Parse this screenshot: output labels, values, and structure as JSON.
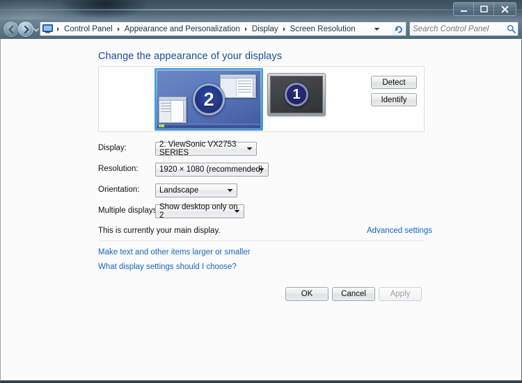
{
  "window": {
    "controls": {
      "minimize": "minimize-button",
      "maximize": "maximize-button",
      "close": "close-button",
      "close_glyph": "X"
    }
  },
  "navbar": {
    "back_tooltip": "Back",
    "forward_tooltip": "Forward",
    "breadcrumbs": [
      "Control Panel",
      "Appearance and Personalization",
      "Display",
      "Screen Resolution"
    ],
    "separator": "▸",
    "dropdown_icon": "chevron-down-icon",
    "refresh_icon": "refresh-icon",
    "search": {
      "placeholder": "Search Control Panel",
      "value": "",
      "icon": "search-icon"
    }
  },
  "page": {
    "title": "Change the appearance of your displays"
  },
  "preview": {
    "monitors": [
      {
        "number": "2",
        "selected": true,
        "active": true,
        "label": "monitor-preview-2"
      },
      {
        "number": "1",
        "selected": false,
        "active": false,
        "label": "monitor-preview-1"
      }
    ],
    "buttons": {
      "detect": "Detect",
      "identify": "Identify"
    }
  },
  "form": {
    "rows": [
      {
        "label": "Display:",
        "value": "2. ViewSonic VX2753 SERIES",
        "name": "display-combo"
      },
      {
        "label": "Resolution:",
        "value": "1920 × 1080 (recommended)",
        "name": "resolution-combo"
      },
      {
        "label": "Orientation:",
        "value": "Landscape",
        "name": "orientation-combo"
      },
      {
        "label": "Multiple displays:",
        "value": "Show desktop only on 2",
        "name": "multiple-displays-combo"
      }
    ]
  },
  "status": {
    "main_display_text": "This is currently your main display.",
    "advanced_settings_link": "Advanced settings"
  },
  "links": {
    "text_size": "Make text and other items larger or smaller",
    "choose_settings": "What display settings should I choose?"
  },
  "dialog_buttons": {
    "ok": "OK",
    "cancel": "Cancel",
    "apply": "Apply",
    "apply_disabled": true
  },
  "colors": {
    "heading_blue": "#184f93",
    "link_blue": "#1766b5",
    "selection_border": "#3c9fe0",
    "content_bg": "#fbfbfc",
    "titlebar_glass": "#52687a"
  }
}
